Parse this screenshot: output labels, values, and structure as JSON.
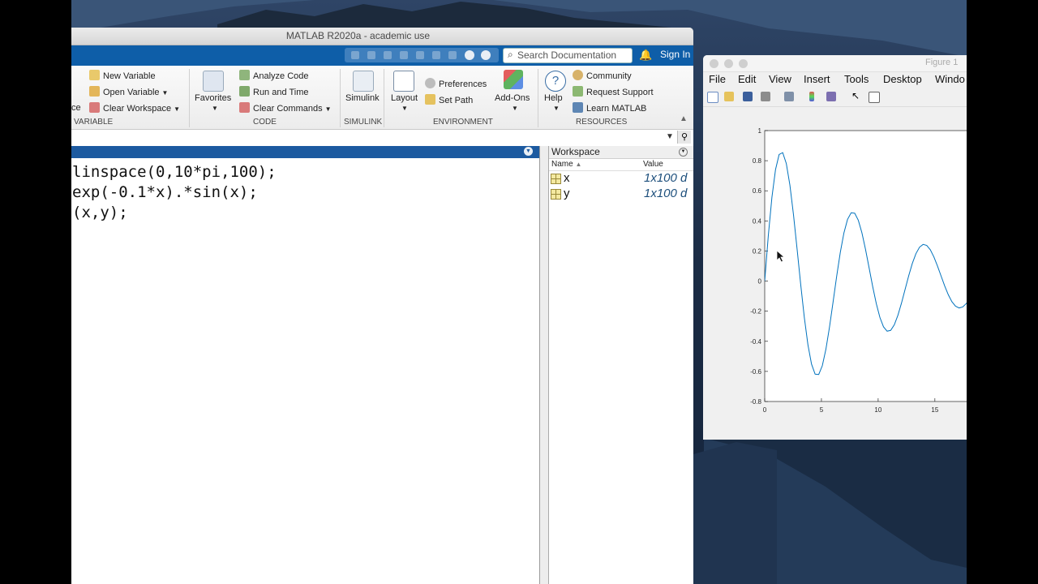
{
  "matlab": {
    "title": "MATLAB R2020a - academic use",
    "search_placeholder": "Search Documentation",
    "sign_in": "Sign In",
    "ribbon": {
      "variable": {
        "new_variable": "New Variable",
        "open_variable": "Open Variable",
        "clear_workspace": "Clear Workspace",
        "partial_label": "ce",
        "section": "VARIABLE"
      },
      "code": {
        "favorites": "Favorites",
        "analyze_code": "Analyze Code",
        "run_and_time": "Run and Time",
        "clear_commands": "Clear Commands",
        "section": "CODE"
      },
      "simulink": {
        "simulink": "Simulink",
        "section": "SIMULINK"
      },
      "environment": {
        "layout": "Layout",
        "preferences": "Preferences",
        "set_path": "Set Path",
        "add_ons": "Add-Ons",
        "section": "ENVIRONMENT"
      },
      "resources": {
        "help": "Help",
        "community": "Community",
        "request_support": "Request Support",
        "learn_matlab": "Learn MATLAB",
        "section": "RESOURCES"
      }
    },
    "command_window": {
      "lines": [
        "linspace(0,10*pi,100);",
        "exp(-0.1*x).*sin(x);",
        "(x,y);"
      ]
    },
    "workspace": {
      "title": "Workspace",
      "col_name": "Name",
      "col_value": "Value",
      "sort_indicator": "▲",
      "rows": [
        {
          "name": "x",
          "value": "1x100 d"
        },
        {
          "name": "y",
          "value": "1x100 d"
        }
      ]
    }
  },
  "figure": {
    "title": "Figure 1",
    "menu": [
      "File",
      "Edit",
      "View",
      "Insert",
      "Tools",
      "Desktop",
      "Windo"
    ],
    "chart_data": {
      "type": "line",
      "title": "",
      "xlabel": "",
      "ylabel": "",
      "function": "y = exp(-0.1*x).*sin(x), x = linspace(0,10*pi,100)",
      "xlim_visible": [
        0,
        17.8
      ],
      "ylim": [
        -0.8,
        1
      ],
      "xticks": [
        "0",
        "5",
        "10",
        "15"
      ],
      "yticks": [
        "1",
        "0.8",
        "0.6",
        "0.4",
        "0.2",
        "0",
        "-0.2",
        "-0.4",
        "-0.6",
        "-0.8"
      ],
      "series": [
        {
          "color": "#0072bd",
          "points": [
            [
              0,
              0
            ],
            [
              1.47,
              0.86
            ],
            [
              3.0,
              0.03
            ],
            [
              4.6,
              -0.62
            ],
            [
              6.2,
              -0.05
            ],
            [
              7.8,
              0.45
            ],
            [
              9.4,
              0.0
            ],
            [
              11.0,
              -0.33
            ],
            [
              12.6,
              0.0
            ],
            [
              14.1,
              0.24
            ],
            [
              15.7,
              0.0
            ],
            [
              17.3,
              -0.17
            ]
          ]
        }
      ]
    }
  },
  "colors": {
    "toolstrip_blue": "#0e5ea8",
    "line_blue": "#0072bd"
  }
}
